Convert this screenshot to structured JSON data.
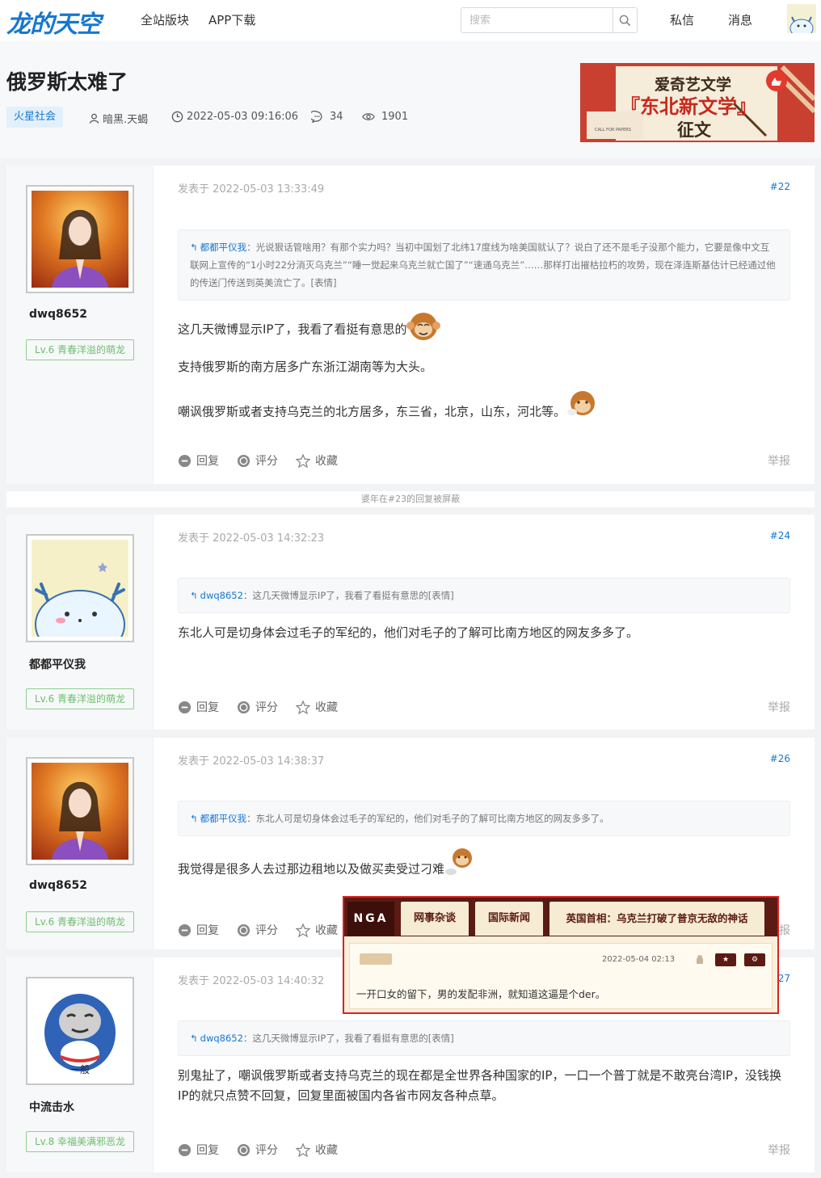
{
  "header": {
    "logo": "龙的天空",
    "nav": [
      "全站版块",
      "APP下载"
    ],
    "search_placeholder": "搜索",
    "right_nav": [
      "私信",
      "消息"
    ]
  },
  "thread": {
    "title": "俄罗斯太难了",
    "section": "火星社会",
    "author": "暗黑.天蝎",
    "datetime": "2022-05-03 09:16:06",
    "comments": "34",
    "views": "1901",
    "banner": {
      "line1": "爱奇艺文学",
      "line2": "『东北新文学』",
      "line3": "征文",
      "small": "CALL FOR PAPERS"
    }
  },
  "labels": {
    "reply": "回复",
    "rate": "评分",
    "fav": "收藏",
    "report": "举报"
  },
  "hidden_notice": "婆年在#23的回复被屏蔽",
  "posts": [
    {
      "user": "dwq8652",
      "level": "Lv.6 青春洋溢的萌龙",
      "date": "发表于 2022-05-03 13:33:49",
      "floor": "#22",
      "quote_user": "都都平仪我",
      "quote_text": "：光说狠话管啥用？有那个实力吗？当初中国划了北纬17度线为啥美国就认了？说白了还不是毛子没那个能力，它要是像中文互联网上宣传的“1小时22分消灭乌克兰”“睡一觉起来乌克兰就亡国了”“速通乌克兰”……那样打出摧枯拉朽的攻势，现在泽连斯基估计已经通过他的传送门传送到英美流亡了。[表情]",
      "text1": "这几天微博显示IP了，我看了看挺有意思的",
      "text2": "支持俄罗斯的南方居多广东浙江湖南等为大头。",
      "text3": "嘲讽俄罗斯或者支持乌克兰的北方居多，东三省，北京，山东，河北等。"
    },
    {
      "user": "都都平仪我",
      "level": "Lv.6 青春洋溢的萌龙",
      "date": "发表于 2022-05-03 14:32:23",
      "floor": "#24",
      "quote_user": "dwq8652",
      "quote_text": "：这几天微博显示IP了，我看了看挺有意思的[表情]",
      "text1": "东北人可是切身体会过毛子的军纪的，他们对毛子的了解可比南方地区的网友多多了。"
    },
    {
      "user": "dwq8652",
      "level": "Lv.6 青春洋溢的萌龙",
      "date": "发表于 2022-05-03 14:38:37",
      "floor": "#26",
      "quote_user": "都都平仪我",
      "quote_text": "：东北人可是切身体会过毛子的军纪的，他们对毛子的了解可比南方地区的网友多多了。",
      "text1": "我觉得是很多人去过那边租地以及做买卖受过刁难"
    },
    {
      "user": "中流击水",
      "level": "Lv.8 幸福美满邪恶龙",
      "avatar_caption": "一般",
      "date": "发表于 2022-05-03 14:40:32",
      "floor": "#27",
      "quote_user": "dwq8652",
      "quote_text": "：这几天微博显示IP了，我看了看挺有意思的[表情]",
      "text1": "别鬼扯了，嘲讽俄罗斯或者支持乌克兰的现在都是全世界各种国家的IP，一口一个普丁就是不敢亮台湾IP，没钱换IP的就只点赞不回复，回复里面被国内各省市网友各种点草。"
    }
  ],
  "popup": {
    "brand": "NGA",
    "tabs": [
      "网事杂谈",
      "国际新闻",
      "英国首相：乌克兰打破了普京无敌的神话"
    ],
    "date": "2022-05-04 02:13",
    "text": "一开口女的留下，男的发配非洲，就知道这逼是个der。"
  },
  "colors": {
    "accent": "#1677d2",
    "level_green": "#6cbf6c",
    "popup_border": "#d92222",
    "popup_brown": "#5b1a12"
  }
}
